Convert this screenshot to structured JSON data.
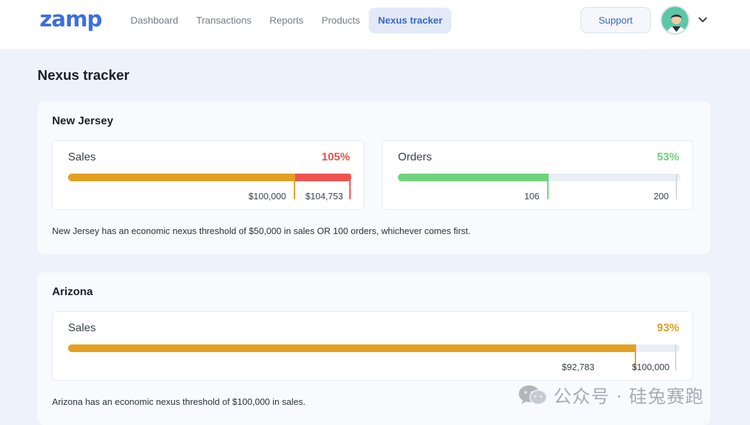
{
  "app": {
    "logo": "zamp",
    "nav": [
      "Dashboard",
      "Transactions",
      "Reports",
      "Products",
      "Nexus tracker"
    ],
    "active_nav": "Nexus tracker",
    "support_label": "Support"
  },
  "page": {
    "title": "Nexus tracker"
  },
  "new_jersey": {
    "name": "New Jersey",
    "sales": {
      "label": "Sales",
      "percent": "105%",
      "threshold_label": "$100,000",
      "current_label": "$104,753",
      "threshold_fraction": 0.7995,
      "current_fraction": 0.9954
    },
    "orders": {
      "label": "Orders",
      "percent": "53%",
      "current_label": "106",
      "threshold_label": "200",
      "current_fraction": 0.53
    },
    "note": "New Jersey has an economic nexus threshold of $50,000 in sales OR 100 orders, whichever comes first."
  },
  "arizona": {
    "name": "Arizona",
    "sales": {
      "label": "Sales",
      "percent": "93%",
      "current_label": "$92,783",
      "threshold_label": "$100,000",
      "current_fraction": 0.9278
    },
    "note": "Arizona has an economic nexus threshold of $100,000 in sales."
  },
  "colors": {
    "accent": "#3766c9",
    "over_red": "#ef5350",
    "warn_orange": "#e3a021",
    "ok_green": "#6fd37c",
    "track": "#e9eef7"
  },
  "watermark": {
    "text": "公众号 · 硅兔赛跑"
  }
}
